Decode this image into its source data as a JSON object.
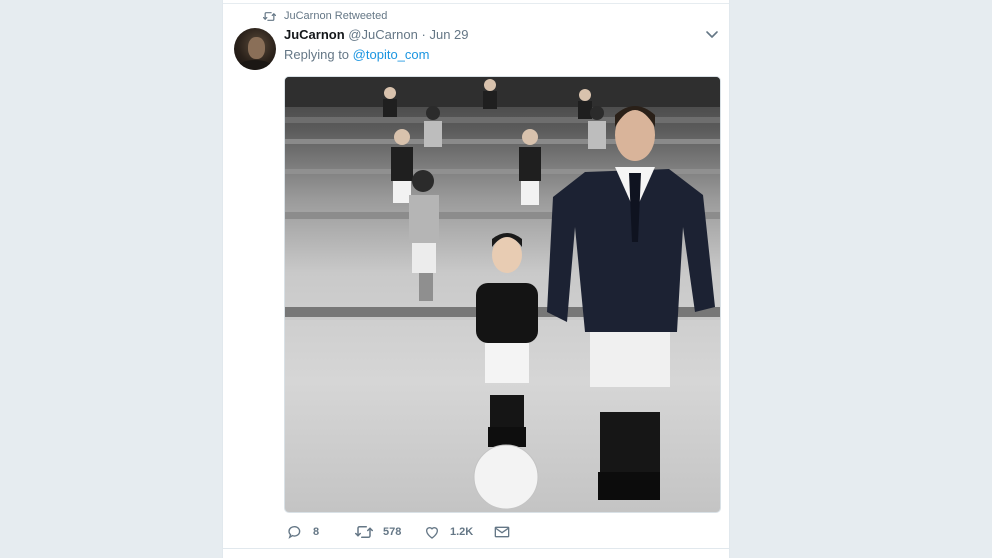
{
  "tweet": {
    "retweet_context": "JuCarnon Retweeted",
    "display_name": "JuCarnon",
    "handle": "@JuCarnon",
    "separator": "·",
    "date": "Jun 29",
    "reply_prefix": "Replying to",
    "reply_to": "@topito_com"
  },
  "actions": {
    "replies": "8",
    "retweets": "578",
    "likes": "1.2K"
  },
  "icons": {
    "retweet_context": "retweet-icon",
    "caret": "chevron-down-icon",
    "reply": "reply-icon",
    "retweet": "retweet-icon",
    "like": "heart-icon",
    "message": "envelope-icon"
  },
  "colors": {
    "link": "#1b95e0",
    "secondary_text": "#657786",
    "background": "#e6ecf0"
  }
}
